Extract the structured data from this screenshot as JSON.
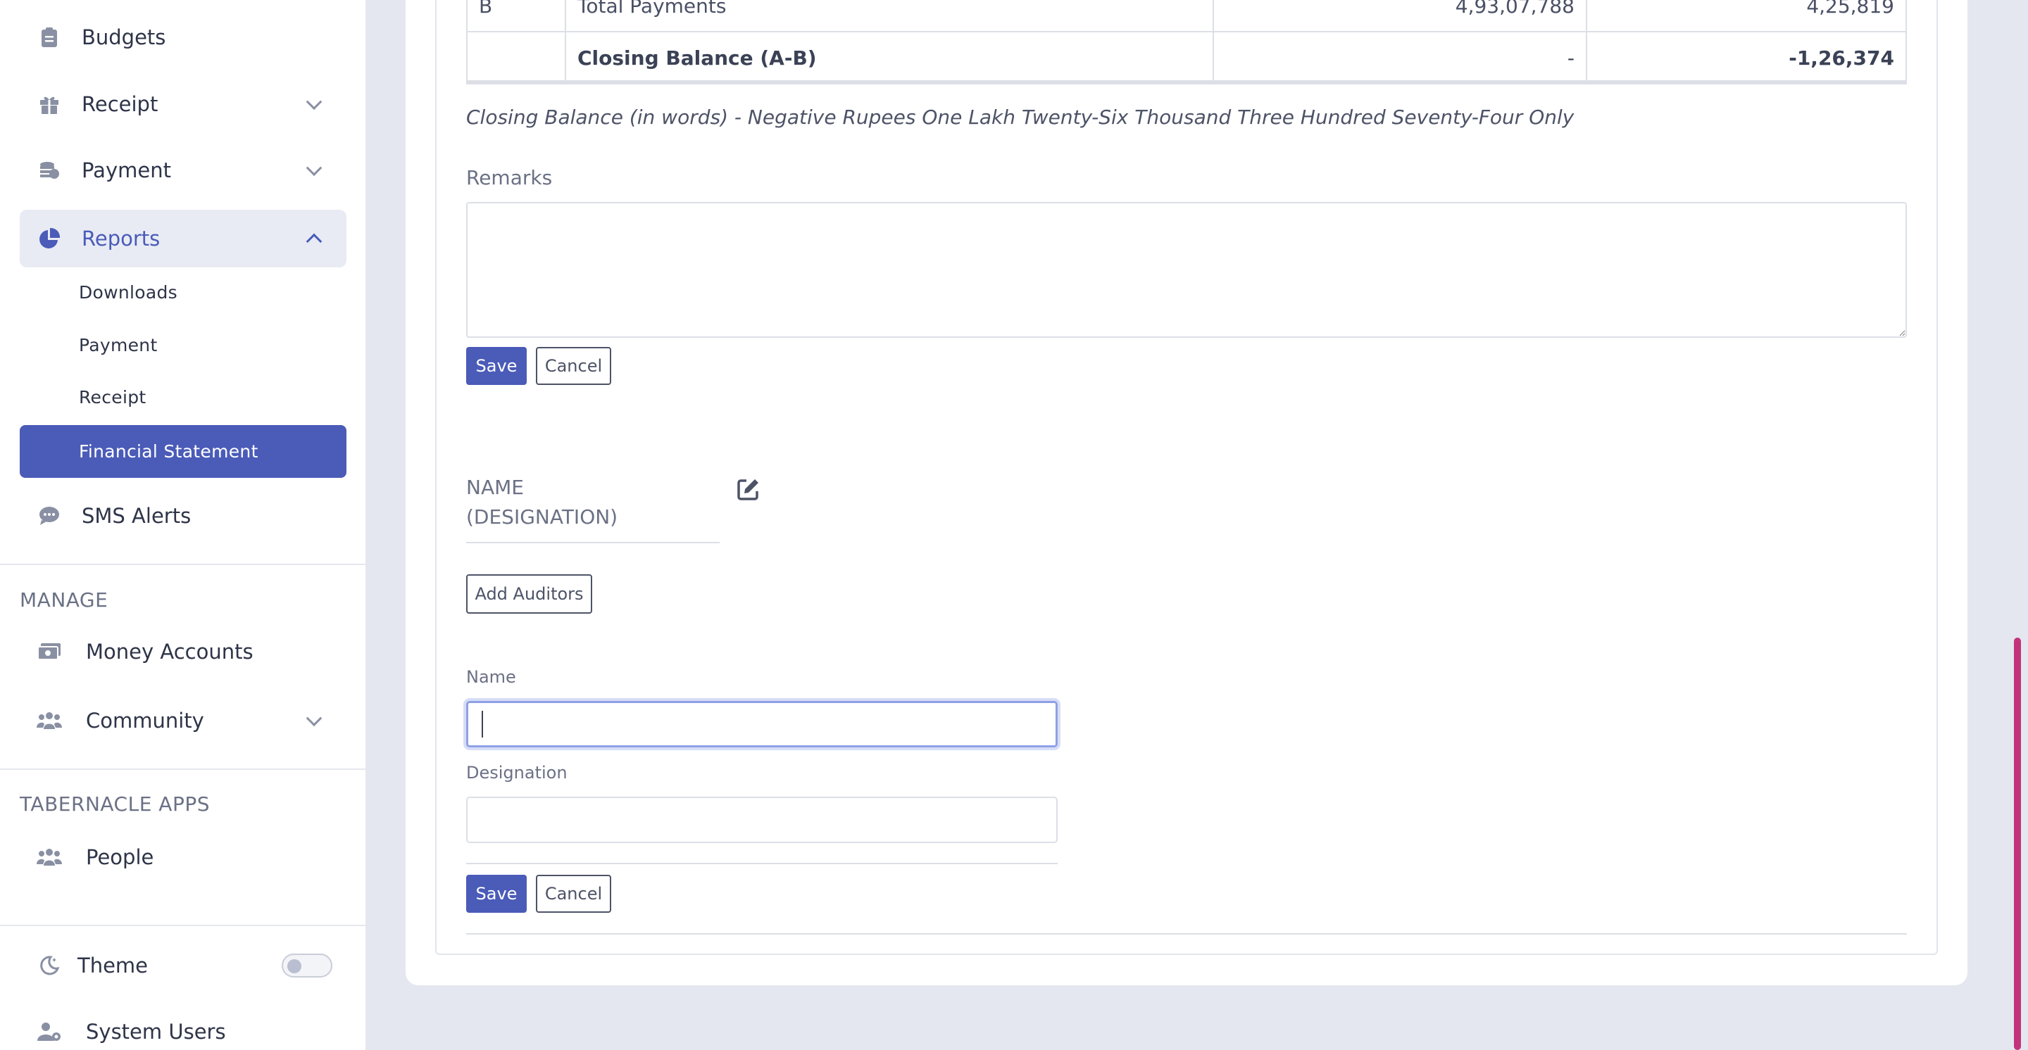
{
  "sidebar": {
    "budgets": "Budgets",
    "receipt": "Receipt",
    "payment": "Payment",
    "reports": "Reports",
    "reports_sub": {
      "downloads": "Downloads",
      "payment": "Payment",
      "receipt": "Receipt",
      "financial_statement": "Financial Statement"
    },
    "sms_alerts": "SMS Alerts",
    "manage_title": "MANAGE",
    "money_accounts": "Money Accounts",
    "community": "Community",
    "apps_title": "TABERNACLE APPS",
    "people": "People",
    "theme": "Theme",
    "system_users": "System Users"
  },
  "table": {
    "rows": [
      {
        "code": "B",
        "label": "Total Payments",
        "col1": "4,93,07,788",
        "col2": "4,25,819"
      },
      {
        "code": "",
        "label": "Closing Balance (A-B)",
        "col1": "-",
        "col2": "-1,26,374"
      }
    ]
  },
  "closing_words": "Closing Balance (in words) - Negative Rupees One Lakh Twenty-Six Thousand Three Hundred Seventy-Four Only",
  "remarks": {
    "label": "Remarks",
    "value": "",
    "save": "Save",
    "cancel": "Cancel"
  },
  "auditor": {
    "name_line1": "NAME",
    "name_line2": "(DESIGNATION)",
    "add_button": "Add Auditors"
  },
  "form": {
    "name_label": "Name",
    "name_value": "",
    "designation_label": "Designation",
    "designation_value": "",
    "save": "Save",
    "cancel": "Cancel"
  },
  "colors": {
    "primary": "#4a5bb8",
    "scrollbar": "#c2337a"
  }
}
